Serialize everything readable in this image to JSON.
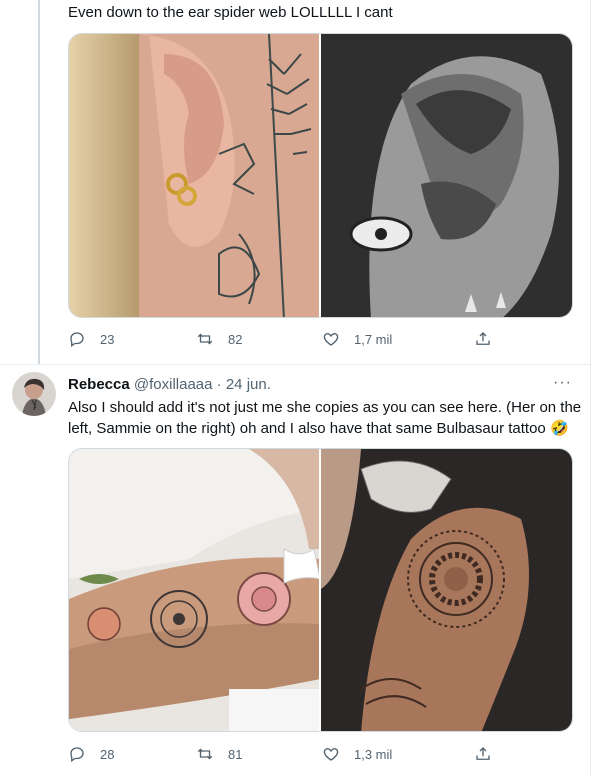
{
  "tweet1": {
    "text": "Even down to the ear spider web LOLLLLL I cant",
    "actions": {
      "replies": "23",
      "retweets": "82",
      "likes": "1,7 mil"
    }
  },
  "tweet2": {
    "author_name": "Rebecca",
    "handle": "@foxillaaaa",
    "separator": "·",
    "date": "24 jun.",
    "more": "···",
    "text_line1": "Also I should add it's not just me she copies as you can see here. (Her on the",
    "text_line2": "left, Sammie on the right) oh and I also have that same Bulbasaur tattoo 🤣",
    "actions": {
      "replies": "28",
      "retweets": "81",
      "likes": "1,3 mil"
    }
  },
  "icons": [
    "reply-icon",
    "retweet-icon",
    "like-icon",
    "share-icon"
  ],
  "colors": {
    "text": "#0f1419",
    "muted": "#536471",
    "border": "#e6ecf0"
  }
}
